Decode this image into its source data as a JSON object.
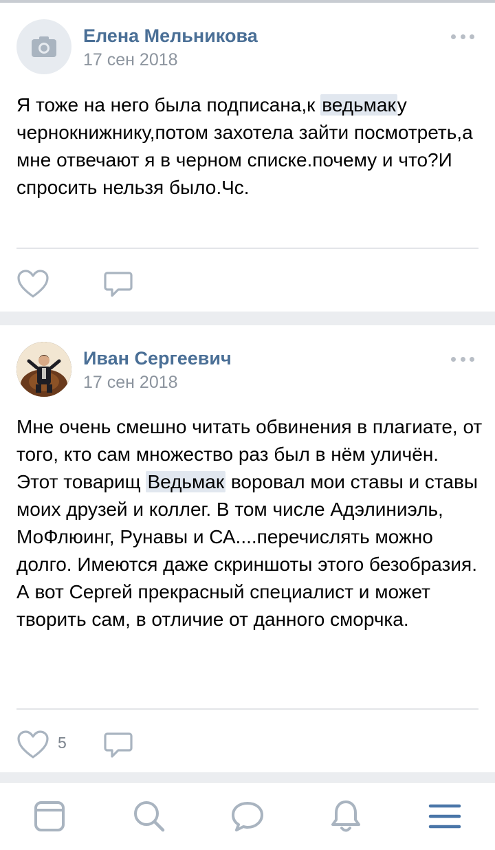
{
  "posts": [
    {
      "author": "Елена Мельникова",
      "date": "17 сен 2018",
      "avatar_icon": "camera-icon",
      "text_parts": [
        "Я тоже на него была подписана,к ",
        "ведьмак",
        "у чернокнижнику,потом захотела зайти посмотреть,а мне отвечают я в черном списке.почему и что?И спросить нельзя было.Чс."
      ],
      "likes": ""
    },
    {
      "author": "Иван Сергеевич",
      "date": "17 сен 2018",
      "avatar_icon": "user-photo",
      "text_parts": [
        "Мне очень смешно читать обвинения в плагиате, от того, кто сам множество раз был в нём уличён.",
        "Этот товарищ ",
        "Ведьмак",
        " воровал мои ставы и ставы моих друзей и коллег. В том числе Адэлиниэль, МоФлюинг, Рунавы и СА....перечислять можно долго. Имеются даже скриншоты этого безобразия. А вот Сергей прекрасный специалист и может творить сам, в отличие от данного сморчка."
      ],
      "likes": "5"
    }
  ],
  "tabbar": {
    "items": [
      "news-icon",
      "search-icon",
      "messages-icon",
      "notifications-icon",
      "menu-icon"
    ],
    "accent": "#4a76a8"
  },
  "colors": {
    "author": "#4a6f96",
    "meta": "#8c949e",
    "icon": "#a9b4c0",
    "divider": "#ebedf0"
  }
}
